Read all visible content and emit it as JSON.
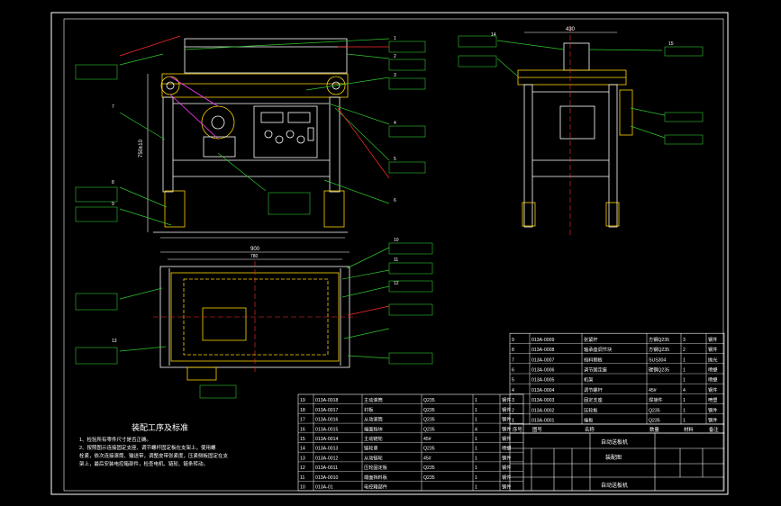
{
  "colors": {
    "background": "#d9dde1",
    "canvas": "#000000",
    "frame": "#ffffff",
    "body_line": "#ffffff",
    "center_line": "#ff3030",
    "dim_line": "#ffffff",
    "leader_green": "#2ec52e",
    "leader_red": "#ff2b2b",
    "label_text": "#ffffff",
    "table_line": "#ffffff",
    "accent_magenta": "#ff3cff"
  },
  "dimensions": {
    "width_top": "430",
    "length_plan": "900",
    "length_plan_inner": "780",
    "height_side": "750±10"
  },
  "callout_numbers": [
    "1",
    "2",
    "3",
    "4",
    "5",
    "6",
    "7",
    "8",
    "9",
    "10",
    "11",
    "12",
    "13",
    "14",
    "15"
  ],
  "assembly_notes": {
    "title": "装配工序及标准",
    "lines": [
      "1、检验所有零件尺寸是否正确。",
      "2、按照图示连接固定支座、调节螺杆固定板在支架上，使用螺",
      "   栓紧，依次连接滚筒、输送带，调整皮带张紧度，压紧侧板固定在支",
      "   架上，最后安装电控箱部件，检查电机、链轮、链条转动。"
    ]
  },
  "bom_lower": [
    {
      "no": "19",
      "code": "013A-0018",
      "name": "主动滚筒",
      "material": "Q235",
      "qty": "1",
      "note": "钢件"
    },
    {
      "no": "18",
      "code": "013A-0017",
      "name": "衬板",
      "material": "Q235",
      "qty": "1",
      "note": "钢件"
    },
    {
      "no": "17",
      "code": "013A-0016",
      "name": "从动滚筒",
      "material": "Q235",
      "qty": "1",
      "note": "钢件"
    },
    {
      "no": "16",
      "code": "013A-0015",
      "name": "端面挡块",
      "material": "Q235",
      "qty": "4",
      "note": "钢件"
    },
    {
      "no": "15",
      "code": "013A-0014",
      "name": "主动链轮",
      "material": "45#",
      "qty": "1",
      "note": "钢件"
    },
    {
      "no": "14",
      "code": "013A-0013",
      "name": "链轮罩",
      "material": "Q235",
      "qty": "1",
      "note": "喷塑"
    },
    {
      "no": "13",
      "code": "013A-0012",
      "name": "从动链轮",
      "material": "45#",
      "qty": "1",
      "note": "钢件"
    },
    {
      "no": "12",
      "code": "013A-0011",
      "name": "压轮固定板",
      "material": "Q235",
      "qty": "1",
      "note": "钢件"
    },
    {
      "no": "11",
      "code": "013A-0010",
      "name": "端面挡料板",
      "material": "Q235",
      "qty": "1",
      "note": "钢件"
    },
    {
      "no": "10",
      "code": "013A-01",
      "name": "电控箱部件",
      "material": "",
      "qty": "1",
      "note": "钢件"
    }
  ],
  "bom_upper": [
    {
      "no": "9",
      "code": "013A-0009",
      "name": "张紧杆",
      "material": "方钢Q235",
      "qty": "3",
      "note": "钢件"
    },
    {
      "no": "8",
      "code": "013A-0008",
      "name": "轴承座调节块",
      "material": "方钢Q235",
      "qty": "2",
      "note": "钢件"
    },
    {
      "no": "7",
      "code": "013A-0007",
      "name": "挡料侧板",
      "material": "SUS304",
      "qty": "1",
      "note": "抛光"
    },
    {
      "no": "6",
      "code": "013A-0006",
      "name": "调节固定座",
      "material": "碳钢Q235",
      "qty": "1",
      "note": "喷塑"
    },
    {
      "no": "5",
      "code": "013A-0005",
      "name": "机架",
      "material": "",
      "qty": "1",
      "note": "喷塑"
    },
    {
      "no": "4",
      "code": "013A-0004",
      "name": "调节螺杆",
      "material": "45#",
      "qty": "4",
      "note": "钢件"
    },
    {
      "no": "3",
      "code": "013A-0003",
      "name": "固定支座",
      "material": "焊接件",
      "qty": "1",
      "note": "喷塑"
    },
    {
      "no": "2",
      "code": "013A-0002",
      "name": "压轮板",
      "material": "Q235",
      "qty": "1",
      "note": "钢件"
    },
    {
      "no": "1",
      "code": "013A-0001",
      "name": "端板",
      "material": "Q235",
      "qty": "1",
      "note": "钢件"
    }
  ],
  "bom_header": [
    "序号",
    "图号",
    "名称",
    "数量",
    "材料",
    "备注"
  ],
  "title_block": {
    "drawing_name": "自动送板机",
    "view_label": "装配图",
    "company": "自动送板机"
  }
}
